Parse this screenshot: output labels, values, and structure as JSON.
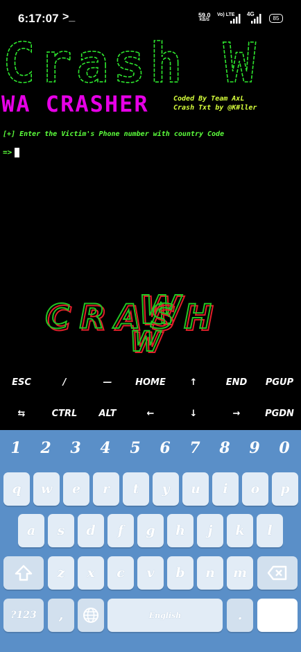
{
  "status_bar": {
    "time": "6:17:07",
    "terminal_glyph": ">_",
    "net_speed_value": "59.0",
    "net_speed_unit": "KB/S",
    "vowifi": "Vo) LTE",
    "lte_label": "4G",
    "battery": "85"
  },
  "terminal": {
    "banner_title": "Crash W",
    "wa_crasher": "WA CRASHER",
    "coded_by": "Coded By Team AxL",
    "crash_txt": "Crash Txt by @K#ller",
    "prompt": "[+] Enter the Victim's Phone number with country Code",
    "input_prompt": "=>",
    "logo_text": "CRASH",
    "logo_w": "W"
  },
  "extra_keys": {
    "row1": [
      "ESC",
      "/",
      "—",
      "HOME",
      "↑",
      "END",
      "PGUP"
    ],
    "row2": [
      "⇆",
      "CTRL",
      "ALT",
      "←",
      "↓",
      "→",
      "PGDN"
    ]
  },
  "keyboard": {
    "numbers": [
      "1",
      "2",
      "3",
      "4",
      "5",
      "6",
      "7",
      "8",
      "9",
      "0"
    ],
    "row1": [
      "q",
      "w",
      "e",
      "r",
      "t",
      "y",
      "u",
      "i",
      "o",
      "p"
    ],
    "row2": [
      "a",
      "s",
      "d",
      "f",
      "g",
      "h",
      "j",
      "k",
      "l"
    ],
    "row3": [
      "z",
      "x",
      "c",
      "v",
      "b",
      "n",
      "m"
    ],
    "sym_key": "?123",
    "comma_key": ",",
    "space_label": "English",
    "period_key": ".",
    "colors": {
      "background": "#5a8fc8",
      "key": "#e2ecf6"
    }
  }
}
